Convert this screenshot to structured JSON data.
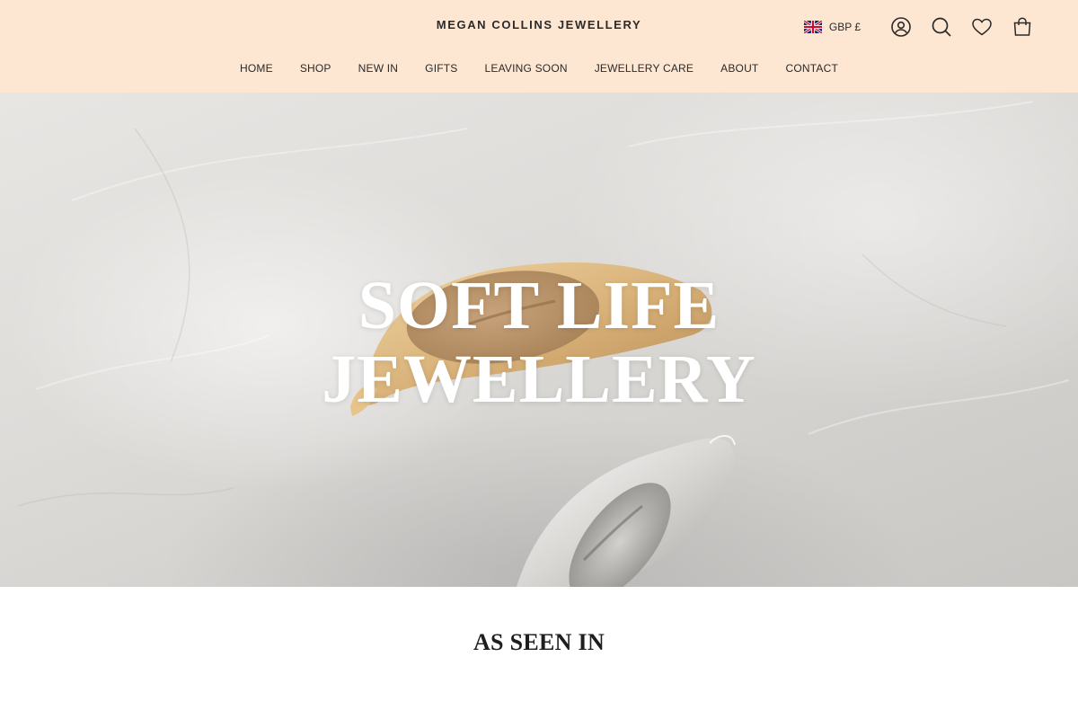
{
  "header": {
    "brand": "MEGAN COLLINS JEWELLERY",
    "currency": {
      "label": "GBP £",
      "flag_icon": "uk-flag-icon"
    },
    "icons": [
      "account-icon",
      "search-icon",
      "wishlist-heart-icon",
      "cart-bag-icon"
    ],
    "background": "#fde6d2"
  },
  "nav": {
    "items": [
      {
        "label": "HOME"
      },
      {
        "label": "SHOP"
      },
      {
        "label": "NEW IN"
      },
      {
        "label": "GIFTS"
      },
      {
        "label": "LEAVING SOON"
      },
      {
        "label": "JEWELLERY CARE"
      },
      {
        "label": "ABOUT"
      },
      {
        "label": "CONTACT"
      }
    ]
  },
  "hero": {
    "title_line1": "SOFT LIFE",
    "title_line2": "JEWELLERY",
    "image": "gold-and-silver-signet-rings-on-stone"
  },
  "section": {
    "as_seen_in": "AS SEEN IN"
  }
}
